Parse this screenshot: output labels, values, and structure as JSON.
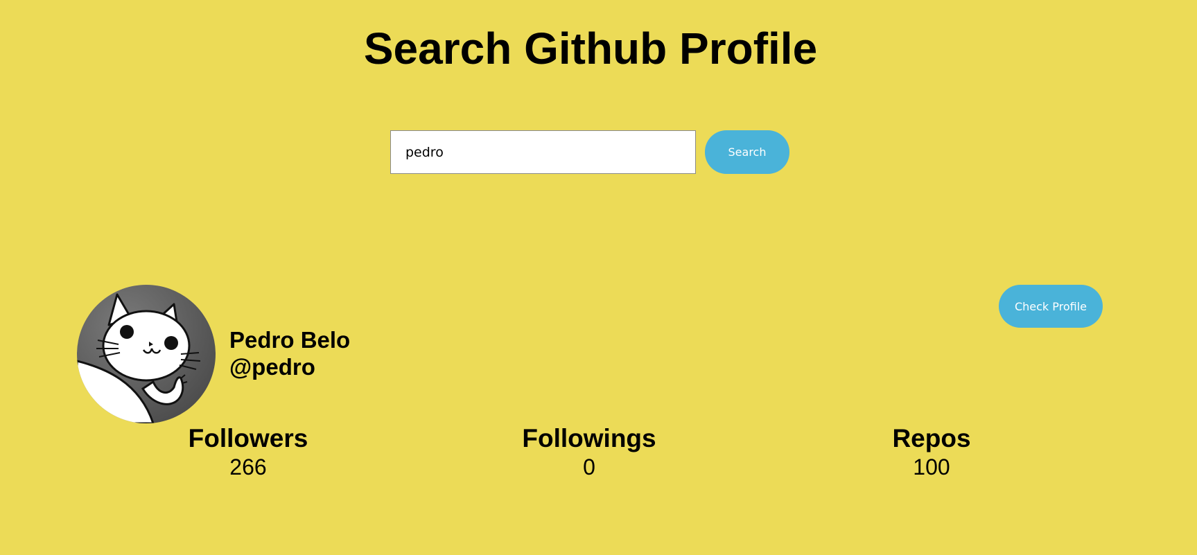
{
  "header": {
    "title": "Search Github Profile"
  },
  "search": {
    "value": "pedro",
    "button_label": "Search"
  },
  "profile": {
    "avatar_icon": "cat-avatar-icon",
    "name": "Pedro Belo",
    "handle": "@pedro",
    "check_button_label": "Check Profile"
  },
  "stats": {
    "followers": {
      "label": "Followers",
      "value": "266"
    },
    "followings": {
      "label": "Followings",
      "value": "0"
    },
    "repos": {
      "label": "Repos",
      "value": "100"
    }
  },
  "colors": {
    "background": "#ecdb57",
    "button": "#4ab3d9",
    "button_text": "#ffffff"
  }
}
